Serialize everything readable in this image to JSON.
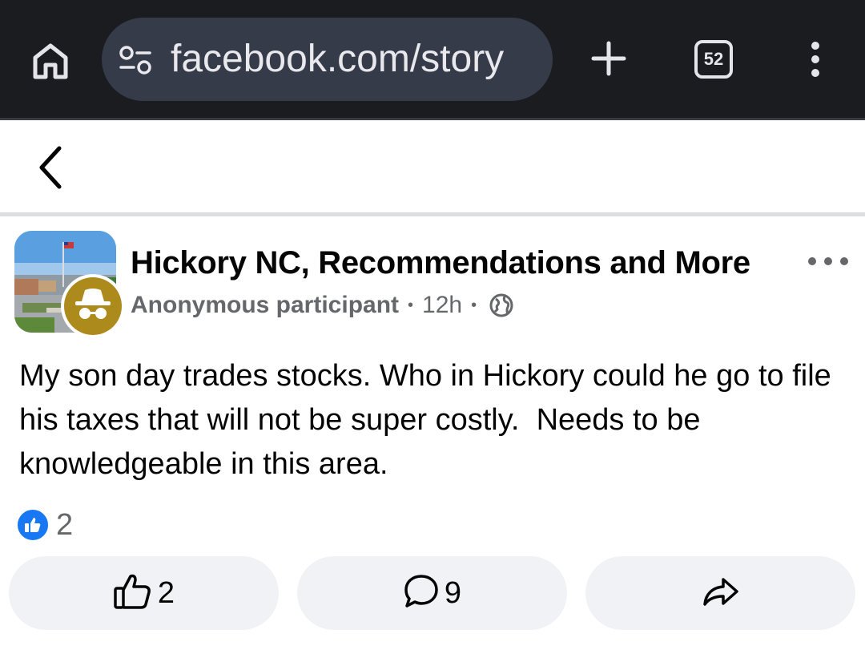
{
  "browser": {
    "url": "facebook.com/story",
    "tab_count": "52",
    "icons": [
      "home-icon",
      "site-settings-icon",
      "plus-icon",
      "tabs-icon",
      "more-vertical-icon"
    ]
  },
  "header": {
    "back_icon": "chevron-left-icon"
  },
  "post": {
    "group_name": "Hickory NC, Recommendations and More",
    "author": "Anonymous participant",
    "time": "12h",
    "separator": "•",
    "audience_icon": "globe-icon",
    "text": "My son day trades stocks. Who in Hickory could he go to file his taxes that will not be super costly.  Needs to be knowledgeable in this area.",
    "reaction_count": "2",
    "actions": {
      "like_count": "2",
      "comment_count": "9",
      "share_icon": "share-arrow-icon"
    }
  },
  "colors": {
    "chrome_bg": "#1b1c20",
    "urlbar_bg": "#363b4a",
    "facebook_blue": "#1877f2",
    "secondary_text": "#65676b",
    "button_bg": "#f0f2f5",
    "anon_gold": "#ad8a1c"
  }
}
